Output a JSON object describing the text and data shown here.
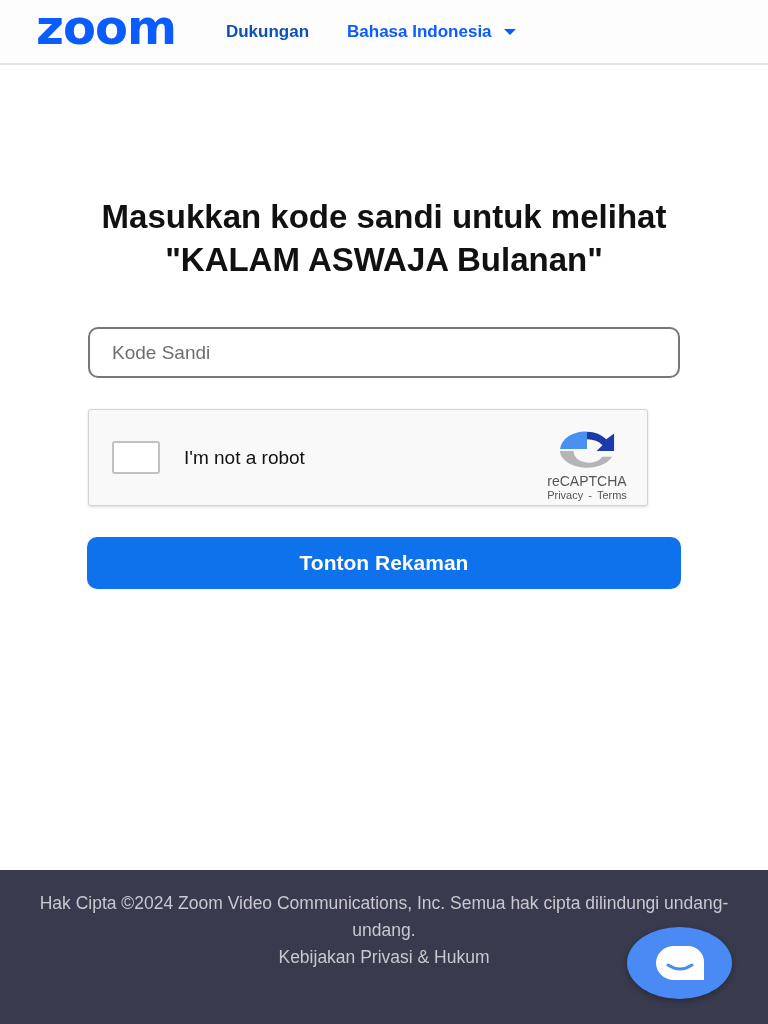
{
  "header": {
    "logo": "zoom",
    "nav": [
      {
        "label": "Dukungan",
        "kind": "link"
      },
      {
        "label": "Bahasa Indonesia",
        "kind": "dropdown"
      }
    ]
  },
  "heading": "Masukkan kode sandi untuk melihat \"KALAM ASWAJA Bulanan\"",
  "passcode_field": {
    "placeholder": "Kode Sandi"
  },
  "captcha": {
    "checked": false,
    "label": "I'm not a robot",
    "brand": "reCAPTCHA",
    "privacy": "Privacy",
    "separator": "-",
    "terms": "Terms"
  },
  "submit_button": "Tonton Rekaman",
  "footer": {
    "copyright": "Hak Cipta ©2024 Zoom Video Communications, Inc. Semua hak cipta dilindungi undang-undang.",
    "link": "Kebijakan Privasi & Hukum"
  }
}
